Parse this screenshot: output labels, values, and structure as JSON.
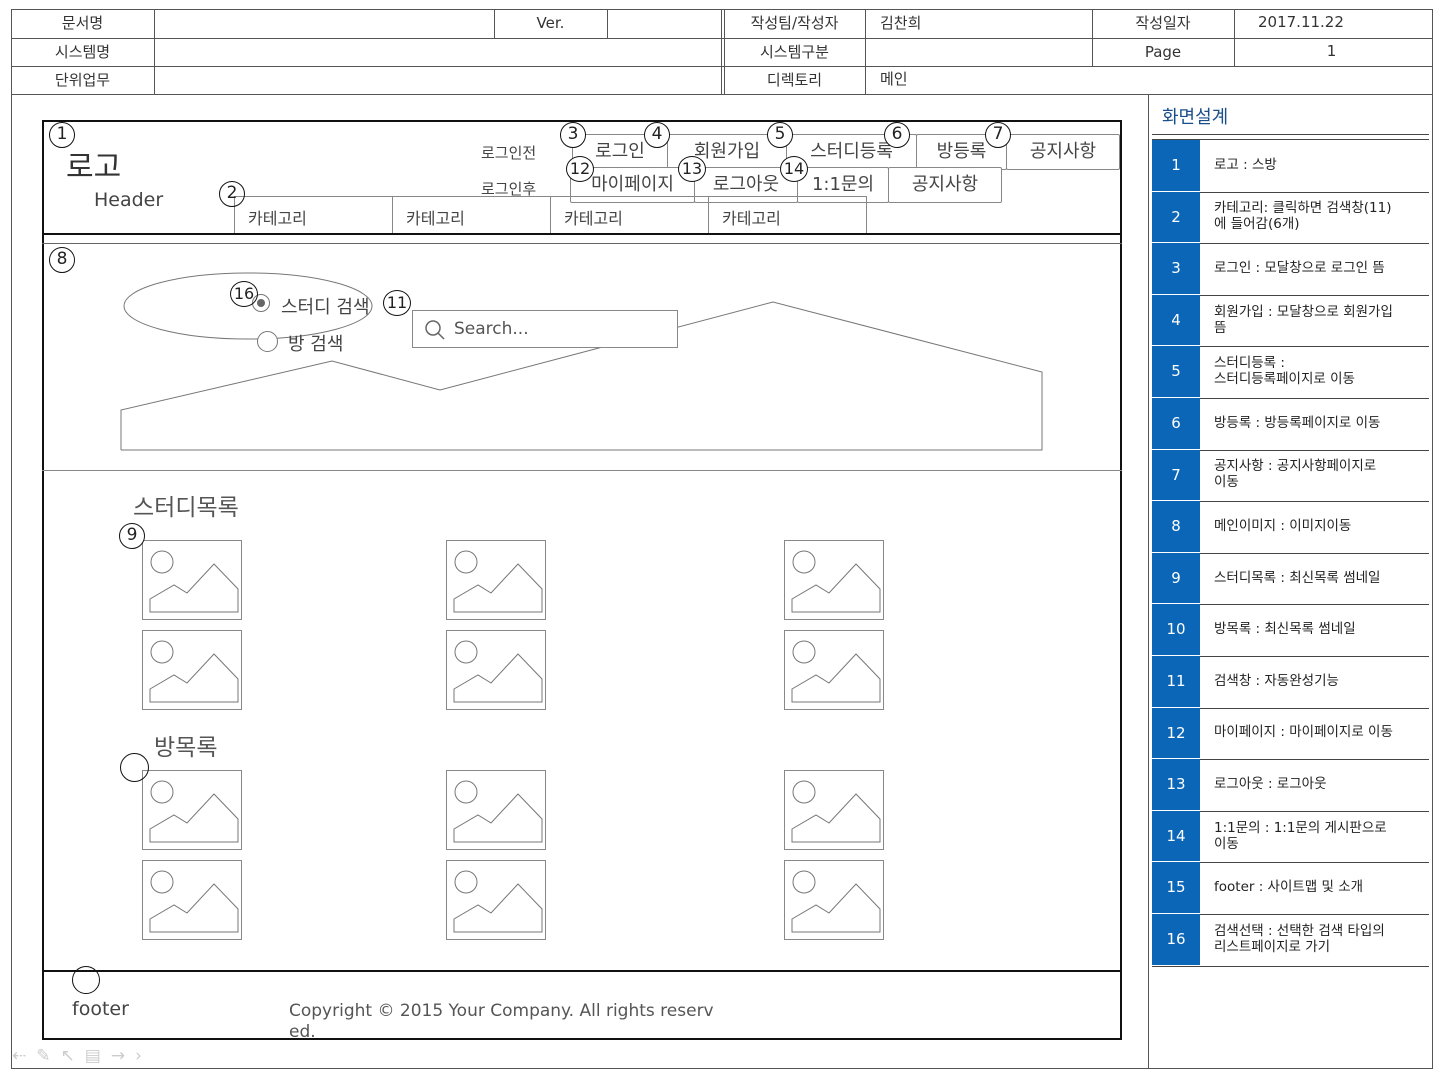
{
  "header_table": {
    "doc_name_label": "문서명",
    "ver_label": "Ver.",
    "team_author_label": "작성팀/작성자",
    "author": "김찬희",
    "date_label": "작성일자",
    "date": "2017.11.22",
    "system_name_label": "시스템명",
    "system_type_label": "시스템구분",
    "page_label": "Page",
    "page_value": "1",
    "unit_task_label": "단위업무",
    "directory_label": "디렉토리",
    "directory_value": "메인"
  },
  "wireframe": {
    "logo": "로고",
    "header_label": "Header",
    "before_login_label": "로그인전",
    "after_login_label": "로그인후",
    "nav_before": [
      "로그인",
      "회원가입",
      "스터디등록",
      "방등록",
      "공지사항"
    ],
    "nav_after": [
      "마이페이지",
      "로그아웃",
      "1:1문의",
      "공지사항"
    ],
    "categories": [
      "카테고리",
      "카테고리",
      "카테고리",
      "카테고리"
    ],
    "search_options": [
      "스터디 검색",
      "방 검색"
    ],
    "search_placeholder": "Search...",
    "study_list_title": "스터디목록",
    "room_list_title": "방목록",
    "footer_label": "footer",
    "copyright_line1": "Copyright © 2015 Your Company. All rights reserv",
    "copyright_line2": "ed."
  },
  "markers": [
    "1",
    "2",
    "3",
    "4",
    "5",
    "6",
    "7",
    "8",
    "9",
    "11",
    "12",
    "13",
    "14",
    "16"
  ],
  "sidebar": {
    "title": "화면설계",
    "accent_color": "#0b66b8",
    "items": [
      {
        "num": "1",
        "text": "로고 : 스방"
      },
      {
        "num": "2",
        "text": "카테고리: 클릭하면 검색창(11)\n에 들어감(6개)"
      },
      {
        "num": "3",
        "text": "로그인 : 모달창으로 로그인 뜸"
      },
      {
        "num": "4",
        "text": "회원가입 : 모달창으로 회원가입\n뜸"
      },
      {
        "num": "5",
        "text": "스터디등록 :\n스터디등록페이지로 이동"
      },
      {
        "num": "6",
        "text": "방등록 : 방등록페이지로 이동"
      },
      {
        "num": "7",
        "text": "공지사항 : 공지사항페이지로\n이동"
      },
      {
        "num": "8",
        "text": "메인이미지 : 이미지이동"
      },
      {
        "num": "9",
        "text": "스터디목록 : 최신목록 썸네일"
      },
      {
        "num": "10",
        "text": "방목록 : 최신목록 썸네일"
      },
      {
        "num": "11",
        "text": "검색창 : 자동완성기능"
      },
      {
        "num": "12",
        "text": "마이페이지 : 마이페이지로 이동"
      },
      {
        "num": "13",
        "text": "로그아웃 : 로그아웃"
      },
      {
        "num": "14",
        "text": "1:1문의 : 1:1문의 게시판으로\n이동"
      },
      {
        "num": "15",
        "text": "footer : 사이트맵 및 소개"
      },
      {
        "num": "16",
        "text": "검색선택 : 선택한 검색 타입의\n리스트페이지로 가기"
      }
    ]
  }
}
